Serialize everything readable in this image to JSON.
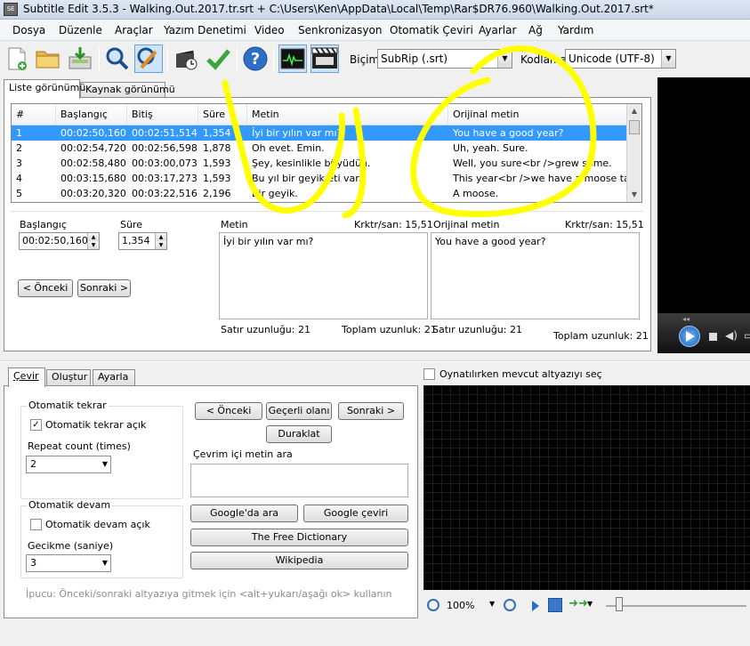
{
  "window": {
    "title": "Subtitle Edit 3.5.3 - Walking.Out.2017.tr.srt + C:\\Users\\Ken\\AppData\\Local\\Temp\\Rar$DR76.960\\Walking.Out.2017.srt*",
    "icon_text": "SE"
  },
  "menu": [
    "Dosya",
    "Düzenle",
    "Araçlar",
    "Yazım Denetimi",
    "Video",
    "Senkronizasyon",
    "Otomatik Çeviri",
    "Ayarlar",
    "Ağ",
    "Yardım"
  ],
  "toolbar": {
    "format_label": "Biçim",
    "format_value": "SubRip (.srt)",
    "encoding_label": "Kodlama",
    "encoding_value": "Unicode (UTF-8)"
  },
  "tabs": {
    "list_view": "Liste görünümü",
    "source_view": "Kaynak görünümü"
  },
  "grid": {
    "headers": [
      "#",
      "Başlangıç",
      "Bitiş",
      "Süre",
      "Metin",
      "Orijinal metin"
    ],
    "rows": [
      [
        "1",
        "00:02:50,160",
        "00:02:51,514",
        "1,354",
        "İyi bir yılın var mı?",
        "You have a good year?"
      ],
      [
        "2",
        "00:02:54,720",
        "00:02:56,598",
        "1,878",
        "Oh evet. Emin.",
        "Uh, yeah. Sure."
      ],
      [
        "3",
        "00:02:58,480",
        "00:03:00,073",
        "1,593",
        "Şey, kesinlikle büyüdün.",
        "Well, you sure<br />grew some."
      ],
      [
        "4",
        "00:03:15,680",
        "00:03:17,273",
        "1,593",
        "Bu yıl bir geyik eti var.",
        "This year<br />we have a moose tag."
      ],
      [
        "5",
        "00:03:20,320",
        "00:03:22,516",
        "2,196",
        "Bir geyik.",
        "A moose."
      ]
    ]
  },
  "editor": {
    "start_label": "Başlangıç",
    "start_value": "00:02:50,160",
    "duration_label": "Süre",
    "duration_value": "1,354",
    "prev_button": "< Önceki",
    "next_button": "Sonraki >",
    "text_label": "Metin",
    "text_cps": "Krktr/san: 15,51",
    "text_value": "İyi bir yılın var mı?",
    "line_length": "Satır uzunluğu: 21",
    "total_length": "Toplam uzunluk: 21",
    "orig_label": "Orijinal metin",
    "orig_cps": "Krktr/san: 15,51",
    "orig_value": "You have a good year?",
    "orig_line_length": "Satır uzunluğu: 21",
    "orig_total_length": "Toplam uzunluk: 21"
  },
  "lower_tabs": [
    "Çevir",
    "Oluştur",
    "Ayarla"
  ],
  "translate": {
    "auto_repeat_title": "Otomatik tekrar",
    "auto_repeat_check": "Otomatik tekrar açık",
    "auto_repeat_checked": true,
    "repeat_count_label": "Repeat count (times)",
    "repeat_count_value": "2",
    "auto_continue_title": "Otomatik devam",
    "auto_continue_check": "Otomatik devam açık",
    "auto_continue_checked": false,
    "delay_label": "Gecikme (saniye)",
    "delay_value": "3",
    "prev_button": "< Önceki",
    "current_button": "Geçerli olanı",
    "next_button": "Sonraki >",
    "pause_button": "Duraklat",
    "search_title": "Çevrim içi metin ara",
    "google_search_button": "Google'da ara",
    "google_translate_button": "Google çeviri",
    "free_dict_button": "The Free Dictionary",
    "wikipedia_button": "Wikipedia",
    "tip": "İpucu: Önceki/sonraki altyazıya gitmek için <alt+yukarı/aşağı ok> kullanın"
  },
  "waveform": {
    "select_current_label": "Oynatılırken mevcut altyazıyı seç",
    "zoom_value": "100%"
  },
  "colors": {
    "selection": "#3399ff",
    "annotation": "#ffff00"
  }
}
